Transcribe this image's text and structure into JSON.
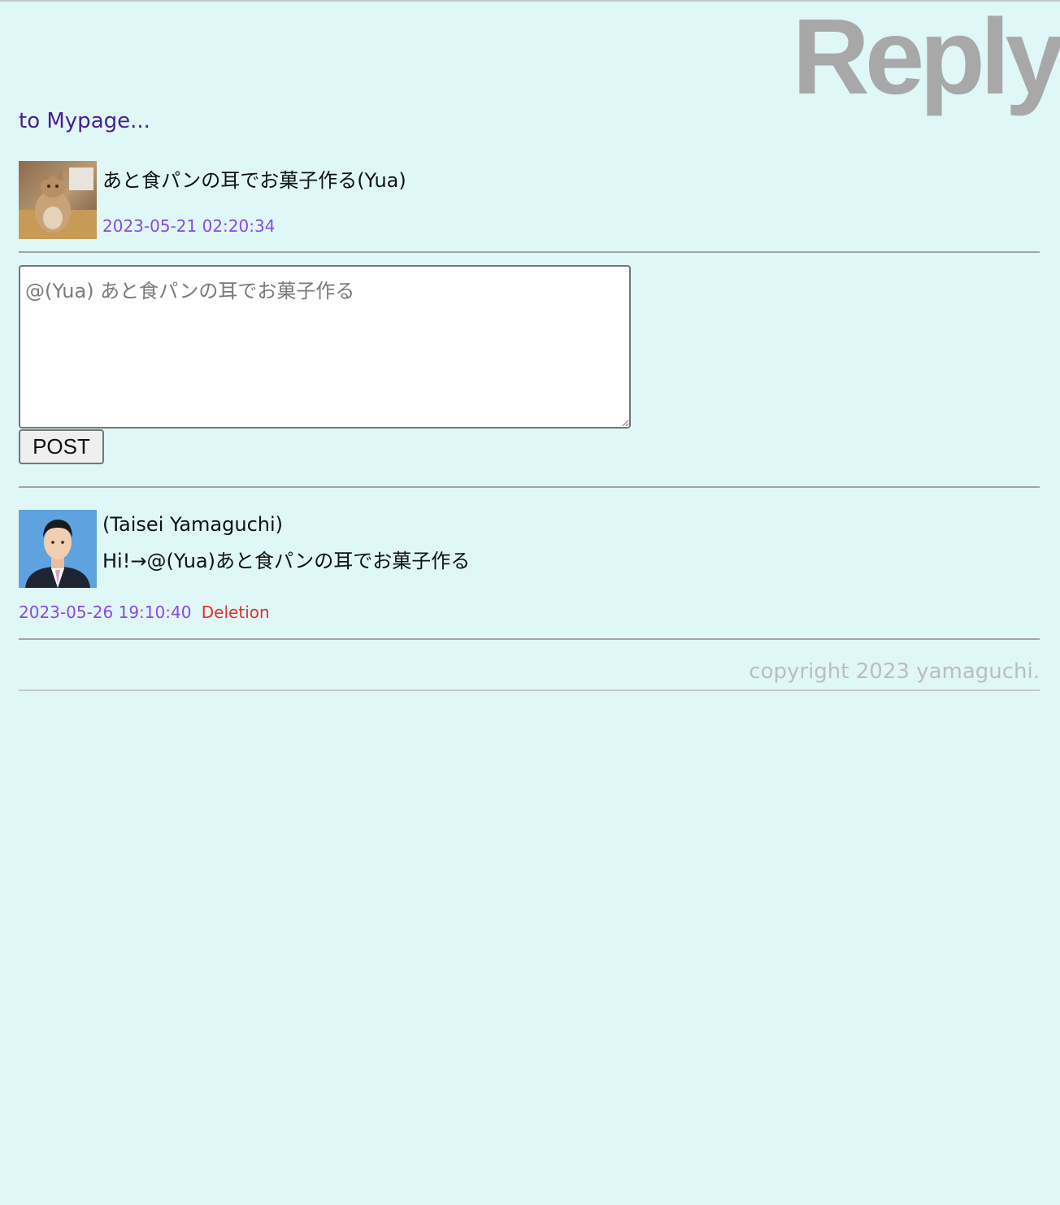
{
  "header": {
    "title": "Reply",
    "mypage_link": "to Mypage..."
  },
  "original_post": {
    "text": "あと食パンの耳でお菓子作る(Yua)",
    "timestamp": "2023-05-21 02:20:34",
    "avatar_icon": "cat-photo"
  },
  "reply_form": {
    "placeholder": "@(Yua) あと食パンの耳でお菓子作る",
    "value": "",
    "submit_label": "POST"
  },
  "replies": [
    {
      "author": "(Taisei Yamaguchi)",
      "body": "Hi!→@(Yua)あと食パンの耳でお菓子作る",
      "timestamp": "2023-05-26 19:10:40",
      "delete_label": "Deletion",
      "avatar_icon": "person-photo"
    }
  ],
  "footer": {
    "copyright": "copyright 2023 yamaguchi."
  },
  "colors": {
    "background": "#dff7f7",
    "title": "#a8a8a8",
    "link": "#4b1f8e",
    "timestamp": "#8a4be0",
    "delete": "#e0322c",
    "copyright": "#bdbdbd"
  }
}
